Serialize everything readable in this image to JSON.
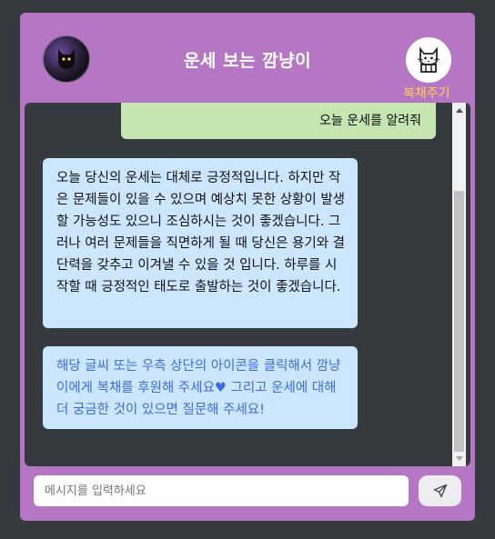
{
  "header": {
    "title": "운세 보는 깜냥이",
    "avatar": "cat-avatar-icon",
    "donate_icon": "cat-icon",
    "donate_label": "복채주기"
  },
  "messages": [
    {
      "role": "user",
      "text": "오늘 운세를 알려줘"
    },
    {
      "role": "bot",
      "text": "오늘 당신의 운세는 대체로 긍정적입니다. 하지만 작은 문제들이 있을 수 있으며 예상치 못한 상황이 발생할 가능성도 있으니 조심하시는 것이 좋겠습니다. 그러나 여러 문제들을 직면하게 될 때 당신은 용기와 결단력을 갖추고 이겨낼 수 있을 것 입니다. 하루를 시작할 때 긍정적인 태도로 출발하는 것이 좋겠습니다."
    },
    {
      "role": "note",
      "text": "해당 글씨 또는 우측 상단의 아이콘을 클릭해서 깜냥이에게 복채를 후원해 주세요♥ 그리고 운세에 대해 더 궁금한 것이 있으면 질문해 주세요!"
    }
  ],
  "composer": {
    "placeholder": "메시지를 입력하세요",
    "value": "",
    "send_icon": "send-icon"
  },
  "colors": {
    "background": "#343a3d",
    "panel": "#b576c4",
    "user_bubble": "#c5e5b1",
    "bot_bubble": "#cce6ff",
    "note_text": "#3c6de0",
    "donate_label": "#ffd24a"
  }
}
